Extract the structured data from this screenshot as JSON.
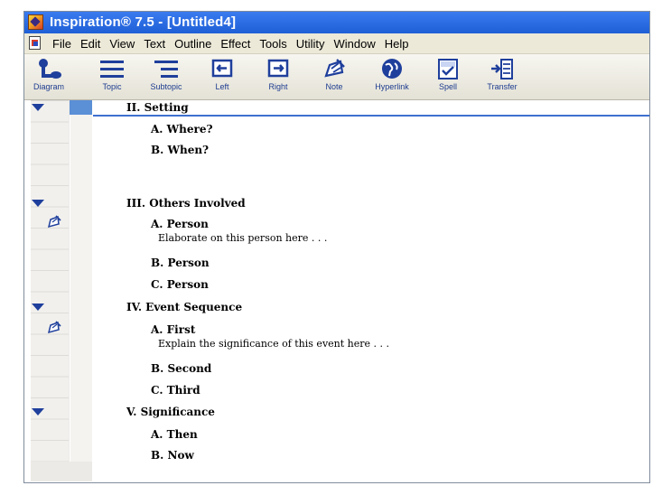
{
  "window": {
    "title": "Inspiration® 7.5 - [Untitled4]"
  },
  "menubar": {
    "items": [
      "File",
      "Edit",
      "View",
      "Text",
      "Outline",
      "Effect",
      "Tools",
      "Utility",
      "Window",
      "Help"
    ]
  },
  "toolbar": {
    "buttons": [
      {
        "label": "Diagram",
        "icon": "diagram-icon"
      },
      {
        "label": "Topic",
        "icon": "topic-icon"
      },
      {
        "label": "Subtopic",
        "icon": "subtopic-icon"
      },
      {
        "label": "Left",
        "icon": "arrow-left-icon"
      },
      {
        "label": "Right",
        "icon": "arrow-right-icon"
      },
      {
        "label": "Note",
        "icon": "note-icon"
      },
      {
        "label": "Hyperlink",
        "icon": "hyperlink-icon"
      },
      {
        "label": "Spell",
        "icon": "spell-icon"
      },
      {
        "label": "Transfer",
        "icon": "transfer-icon"
      }
    ]
  },
  "outline": {
    "topics": [
      {
        "label": "II. Setting",
        "subtopics": [
          {
            "label": "A. Where?"
          },
          {
            "label": "B. When?"
          }
        ]
      },
      {
        "label": "III. Others Involved",
        "subtopics": [
          {
            "label": "A. Person",
            "note": "Elaborate on this person here . . ."
          },
          {
            "label": "B. Person"
          },
          {
            "label": "C. Person"
          }
        ]
      },
      {
        "label": "IV. Event Sequence",
        "subtopics": [
          {
            "label": "A. First",
            "note": "Explain the significance of this event here . . ."
          },
          {
            "label": "B. Second"
          },
          {
            "label": "C. Third"
          }
        ]
      },
      {
        "label": "V. Significance",
        "subtopics": [
          {
            "label": "A. Then"
          },
          {
            "label": "B. Now"
          }
        ]
      }
    ]
  },
  "colors": {
    "titlebar": "#2563e0",
    "icon_blue": "#1f3f9c",
    "selection": "#5b8fd6"
  }
}
